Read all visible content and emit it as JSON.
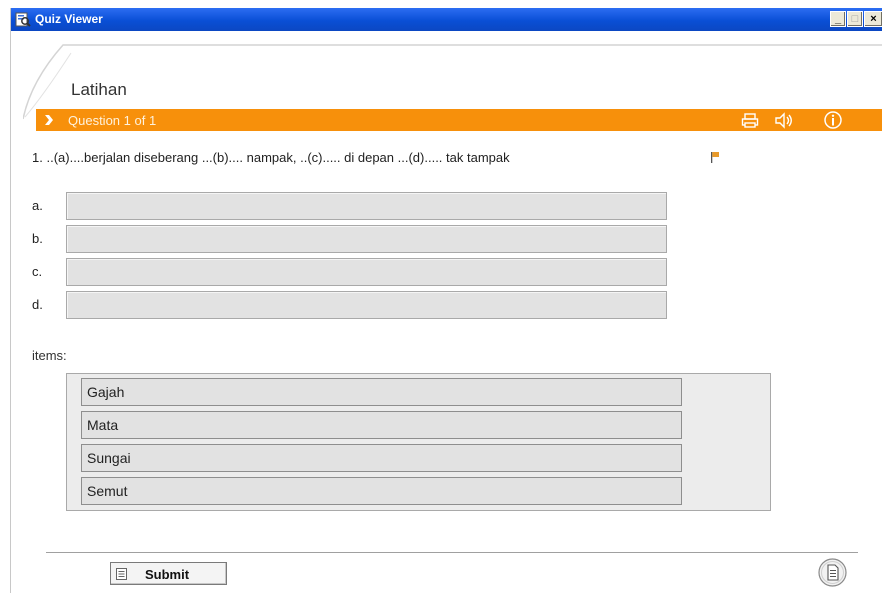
{
  "window": {
    "title": "Quiz Viewer",
    "minimize_glyph": "_",
    "maximize_glyph": "□",
    "close_glyph": "×",
    "icon": "quiz-viewer-icon"
  },
  "section": {
    "title": "Latihan"
  },
  "question_bar": {
    "label": "Question 1 of 1",
    "color": "#f7900b",
    "icons": [
      "print-icon",
      "speaker-icon",
      "info-icon"
    ]
  },
  "question": {
    "number": "1.",
    "text": "..(a)....berjalan diseberang ...(b).... nampak, ..(c)..... di depan ...(d)..... tak tampak",
    "flag_icon": "flag-icon"
  },
  "blanks": [
    {
      "label": "a.",
      "value": ""
    },
    {
      "label": "b.",
      "value": ""
    },
    {
      "label": "c.",
      "value": ""
    },
    {
      "label": "d.",
      "value": ""
    }
  ],
  "items_label": "items:",
  "items": [
    "Gajah",
    "Mata",
    "Sungai",
    "Semut"
  ],
  "footer": {
    "submit_label": "Submit",
    "submit_icon": "list-icon",
    "notes_icon": "notes-icon"
  }
}
